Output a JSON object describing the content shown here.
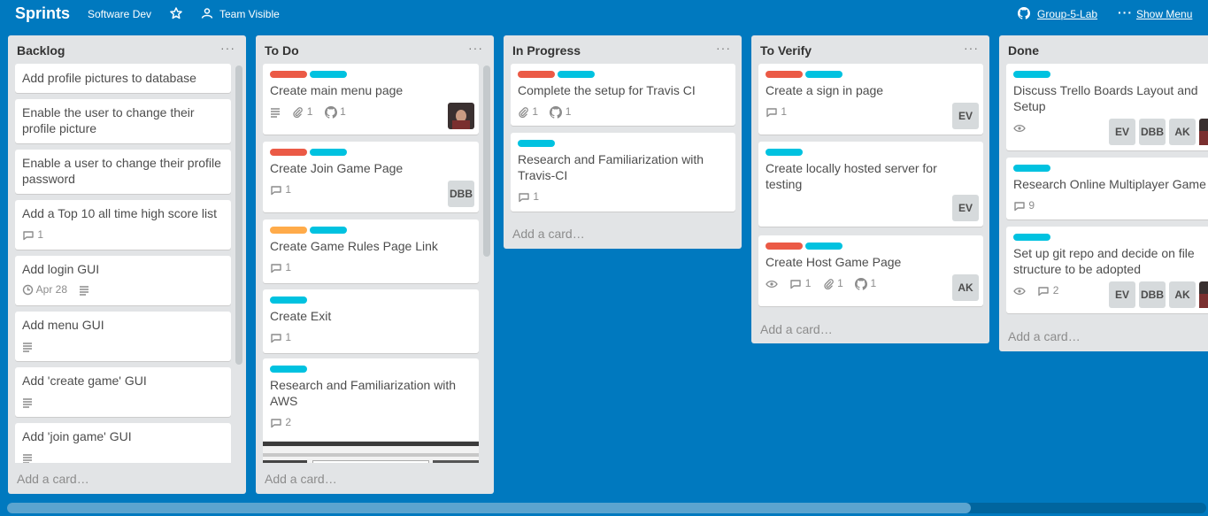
{
  "header": {
    "board_title": "Sprints",
    "team": "Software Dev",
    "visibility": "Team Visible",
    "org_link": "Group-5-Lab",
    "menu_label": "Show Menu",
    "menu_icon": "ellipsis-icon"
  },
  "colors": {
    "background": "#0079bf",
    "label_red": "#eb5a46",
    "label_sky": "#00c2e0",
    "label_orange": "#ffab4a"
  },
  "add_card_label": "Add a card…",
  "lists": [
    {
      "title": "Backlog",
      "cards": [
        {
          "title": "Add profile pictures to database"
        },
        {
          "title": "Enable the user to change their profile picture"
        },
        {
          "title": "Enable a user to change their profile password"
        },
        {
          "title": "Add a Top 10 all time high score list",
          "comments": "1"
        },
        {
          "title": "Add login GUI",
          "due": "Apr 28"
        },
        {
          "title": "Add menu GUI"
        },
        {
          "title": "Add 'create game' GUI"
        },
        {
          "title": "Add 'join game' GUI"
        }
      ]
    },
    {
      "title": "To Do",
      "cards": [
        {
          "title": "Create main menu page",
          "attachments": "1",
          "github": "1"
        },
        {
          "title": "Create Join Game Page",
          "comments": "1",
          "member": "DBB"
        },
        {
          "title": "Create Game Rules Page Link",
          "comments": "1"
        },
        {
          "title": "Create Exit",
          "comments": "1"
        },
        {
          "title": "Research and Familiarization with AWS",
          "comments": "2"
        }
      ]
    },
    {
      "title": "In Progress",
      "cards": [
        {
          "title": "Complete the setup for Travis CI",
          "attachments": "1",
          "github": "1"
        },
        {
          "title": "Research and Familiarization with Travis-CI",
          "comments": "1"
        }
      ]
    },
    {
      "title": "To Verify",
      "cards": [
        {
          "title": "Create a sign in page",
          "comments": "1",
          "member": "EV"
        },
        {
          "title": "Create locally hosted server for testing",
          "member": "EV"
        },
        {
          "title": "Create Host Game Page",
          "comments": "1",
          "attachments": "1",
          "github": "1",
          "member": "AK"
        }
      ]
    },
    {
      "title": "Done",
      "cards": [
        {
          "title": "Discuss Trello Boards Layout and Setup",
          "members": [
            "EV",
            "DBB",
            "AK"
          ]
        },
        {
          "title": "Research Online Multiplayer Game",
          "comments": "9"
        },
        {
          "title": "Set up git repo and decide on file structure to be adopted",
          "comments": "2",
          "members": [
            "EV",
            "DBB",
            "AK"
          ]
        }
      ]
    }
  ]
}
